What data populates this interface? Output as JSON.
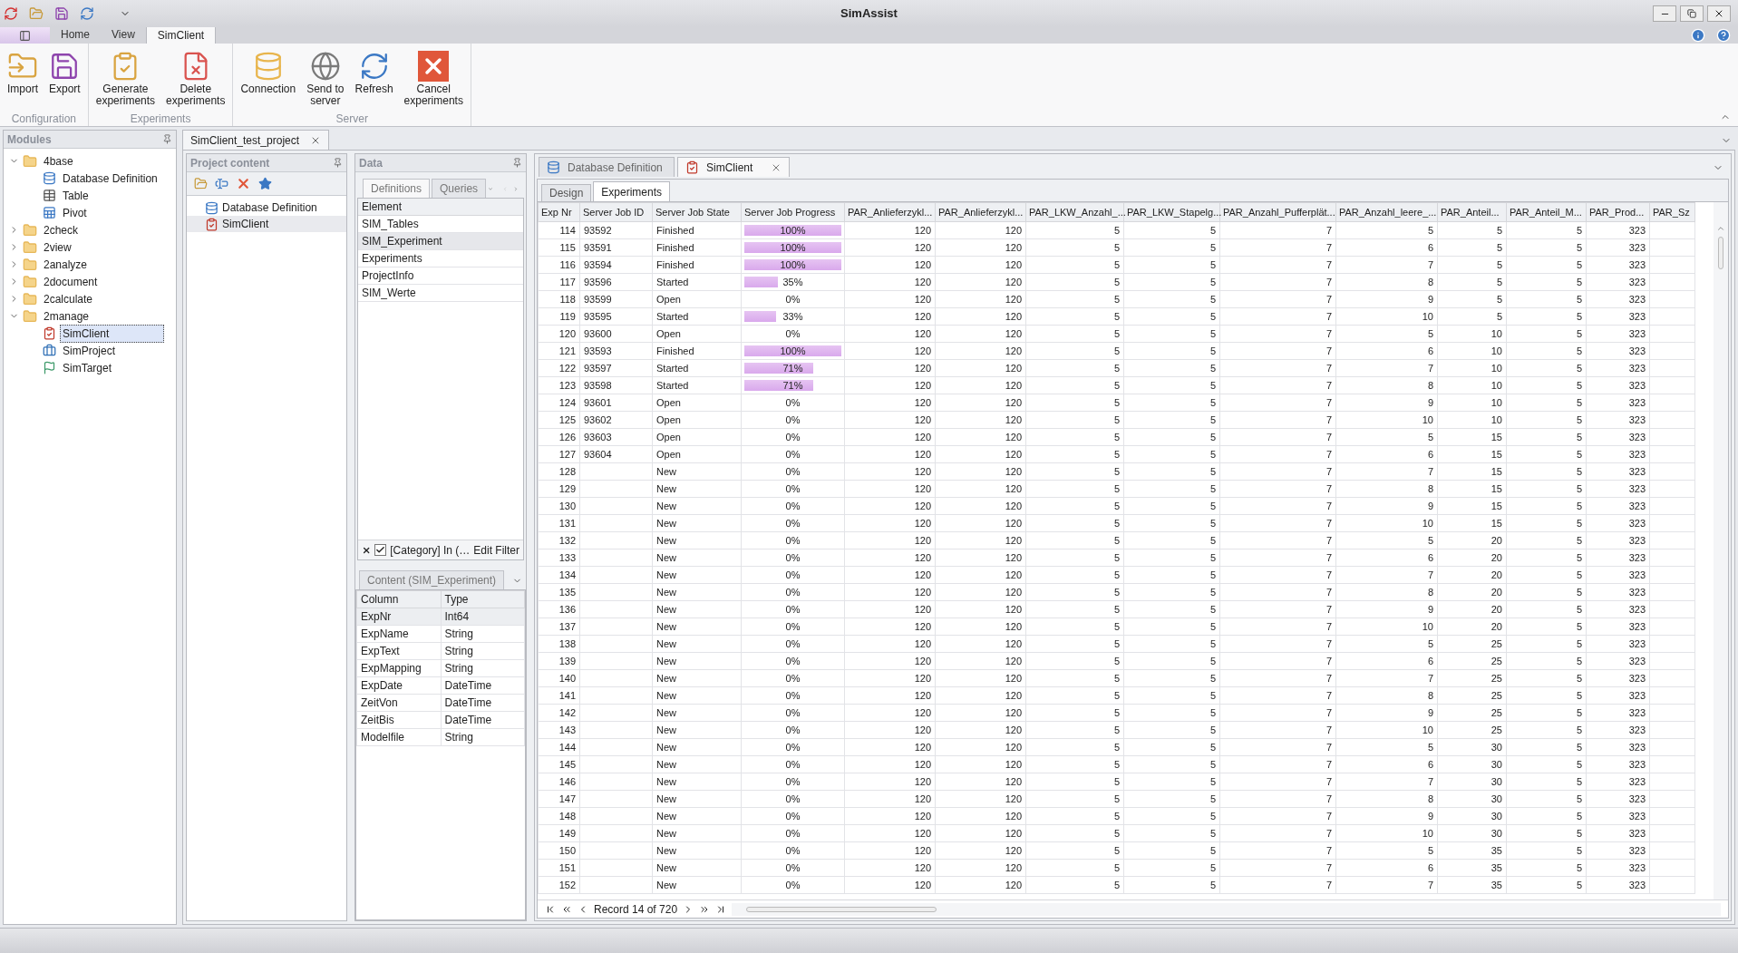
{
  "window": {
    "title": "SimAssist"
  },
  "ribbon": {
    "tabs": [
      {
        "label": "Home",
        "selected": false
      },
      {
        "label": "View",
        "selected": false
      },
      {
        "label": "SimClient",
        "selected": true
      }
    ],
    "groups": [
      {
        "label": "Configuration",
        "buttons": [
          {
            "kind": "import",
            "label": "Import"
          },
          {
            "kind": "export",
            "label": "Export"
          }
        ]
      },
      {
        "label": "Experiments",
        "buttons": [
          {
            "kind": "generate",
            "label": "Generate\nexperiments"
          },
          {
            "kind": "delete",
            "label": "Delete\nexperiments"
          }
        ]
      },
      {
        "label": "Server",
        "buttons": [
          {
            "kind": "connection",
            "label": "Connection"
          },
          {
            "kind": "send",
            "label": "Send to\nserver"
          },
          {
            "kind": "refresh",
            "label": "Refresh"
          },
          {
            "kind": "cancel",
            "label": "Cancel\nexperiments"
          }
        ]
      }
    ]
  },
  "modules": {
    "title": "Modules",
    "tree": [
      {
        "label": "4base",
        "expanded": true,
        "children": [
          {
            "kind": "database",
            "label": "Database Definition",
            "selected": false
          },
          {
            "kind": "table",
            "label": "Table",
            "selected": false
          },
          {
            "kind": "pivot",
            "label": "Pivot",
            "selected": false
          }
        ]
      },
      {
        "label": "2check",
        "expanded": false
      },
      {
        "label": "2view",
        "expanded": false
      },
      {
        "label": "2analyze",
        "expanded": false
      },
      {
        "label": "2document",
        "expanded": false
      },
      {
        "label": "2calculate",
        "expanded": false
      },
      {
        "label": "2manage",
        "expanded": true,
        "children": [
          {
            "kind": "client",
            "label": "SimClient",
            "selected": true
          },
          {
            "kind": "project",
            "label": "SimProject",
            "selected": false
          },
          {
            "kind": "target",
            "label": "SimTarget",
            "selected": false
          }
        ]
      }
    ]
  },
  "document_tab": {
    "label": "SimClient_test_project"
  },
  "project_content": {
    "title": "Project content",
    "items": [
      {
        "kind": "database",
        "label": "Database Definition",
        "selected": false
      },
      {
        "kind": "client",
        "label": "SimClient",
        "selected": true
      }
    ]
  },
  "data": {
    "title": "Data",
    "tabs": [
      {
        "label": "Definitions",
        "selected": true
      },
      {
        "label": "Queries",
        "selected": false
      }
    ],
    "header": "Element",
    "items": [
      {
        "label": "SIM_Tables",
        "selected": false
      },
      {
        "label": "SIM_Experiment",
        "selected": true
      },
      {
        "label": "Experiments",
        "selected": false
      },
      {
        "label": "ProjectInfo",
        "selected": false
      },
      {
        "label": "SIM_Werte",
        "selected": false
      }
    ],
    "filter": {
      "checked": true,
      "text": "[Category] In (…",
      "action": "Edit Filter"
    },
    "content": {
      "title": "Content (SIM_Experiment)",
      "columns": [
        "Column",
        "Type"
      ],
      "rows": [
        {
          "cells": [
            "ExpNr",
            "Int64"
          ],
          "selected": true
        },
        {
          "cells": [
            "ExpName",
            "String"
          ],
          "selected": false
        },
        {
          "cells": [
            "ExpText",
            "String"
          ],
          "selected": false
        },
        {
          "cells": [
            "ExpMapping",
            "String"
          ],
          "selected": false
        },
        {
          "cells": [
            "ExpDate",
            "DateTime"
          ],
          "selected": false
        },
        {
          "cells": [
            "ZeitVon",
            "DateTime"
          ],
          "selected": false
        },
        {
          "cells": [
            "ZeitBis",
            "DateTime"
          ],
          "selected": false
        },
        {
          "cells": [
            "Modelfile",
            "String"
          ],
          "selected": false
        }
      ]
    }
  },
  "editor": {
    "tabs": [
      {
        "kind": "database",
        "label": "Database Definition",
        "selected": false
      },
      {
        "kind": "client",
        "label": "SimClient",
        "selected": true
      }
    ],
    "subtabs": [
      {
        "label": "Design",
        "selected": false
      },
      {
        "label": "Experiments",
        "selected": true
      }
    ],
    "columns": [
      "Exp Nr",
      "Server Job ID",
      "Server Job State",
      "Server Job Progress",
      "PAR_Anlieferzykl...",
      "PAR_Anlieferzykl...",
      "PAR_LKW_Anzahl_...",
      "PAR_LKW_Stapelg...",
      "PAR_Anzahl_Pufferplät...",
      "PAR_Anzahl_leere_...",
      "PAR_Anteil...",
      "PAR_Anteil_M...",
      "PAR_Prod...",
      "PAR_Sz"
    ],
    "rows": [
      {
        "exp_nr": "114",
        "job_id": "93592",
        "state": "Finished",
        "level": 1,
        "progress": "100%",
        "values": [
          "120",
          "120",
          "5",
          "5",
          "7",
          "5",
          "5",
          "5",
          "323"
        ]
      },
      {
        "exp_nr": "115",
        "job_id": "93591",
        "state": "Finished",
        "level": 1,
        "progress": "100%",
        "values": [
          "120",
          "120",
          "5",
          "5",
          "7",
          "6",
          "5",
          "5",
          "323"
        ]
      },
      {
        "exp_nr": "116",
        "job_id": "93594",
        "state": "Finished",
        "level": 1,
        "progress": "100%",
        "values": [
          "120",
          "120",
          "5",
          "5",
          "7",
          "7",
          "5",
          "5",
          "323"
        ]
      },
      {
        "exp_nr": "117",
        "job_id": "93596",
        "state": "Started",
        "level": 0.35,
        "progress": "35%",
        "values": [
          "120",
          "120",
          "5",
          "5",
          "7",
          "8",
          "5",
          "5",
          "323"
        ]
      },
      {
        "exp_nr": "118",
        "job_id": "93599",
        "state": "Open",
        "level": 0,
        "progress": "0%",
        "values": [
          "120",
          "120",
          "5",
          "5",
          "7",
          "9",
          "5",
          "5",
          "323"
        ]
      },
      {
        "exp_nr": "119",
        "job_id": "93595",
        "state": "Started",
        "level": 0.33,
        "progress": "33%",
        "values": [
          "120",
          "120",
          "5",
          "5",
          "7",
          "10",
          "5",
          "5",
          "323"
        ]
      },
      {
        "exp_nr": "120",
        "job_id": "93600",
        "state": "Open",
        "level": 0,
        "progress": "0%",
        "values": [
          "120",
          "120",
          "5",
          "5",
          "7",
          "5",
          "10",
          "5",
          "323"
        ]
      },
      {
        "exp_nr": "121",
        "job_id": "93593",
        "state": "Finished",
        "level": 1,
        "progress": "100%",
        "values": [
          "120",
          "120",
          "5",
          "5",
          "7",
          "6",
          "10",
          "5",
          "323"
        ]
      },
      {
        "exp_nr": "122",
        "job_id": "93597",
        "state": "Started",
        "level": 0.71,
        "progress": "71%",
        "values": [
          "120",
          "120",
          "5",
          "5",
          "7",
          "7",
          "10",
          "5",
          "323"
        ]
      },
      {
        "exp_nr": "123",
        "job_id": "93598",
        "state": "Started",
        "level": 0.71,
        "progress": "71%",
        "values": [
          "120",
          "120",
          "5",
          "5",
          "7",
          "8",
          "10",
          "5",
          "323"
        ]
      },
      {
        "exp_nr": "124",
        "job_id": "93601",
        "state": "Open",
        "level": 0,
        "progress": "0%",
        "values": [
          "120",
          "120",
          "5",
          "5",
          "7",
          "9",
          "10",
          "5",
          "323"
        ]
      },
      {
        "exp_nr": "125",
        "job_id": "93602",
        "state": "Open",
        "level": 0,
        "progress": "0%",
        "values": [
          "120",
          "120",
          "5",
          "5",
          "7",
          "10",
          "10",
          "5",
          "323"
        ]
      },
      {
        "exp_nr": "126",
        "job_id": "93603",
        "state": "Open",
        "level": 0,
        "progress": "0%",
        "values": [
          "120",
          "120",
          "5",
          "5",
          "7",
          "5",
          "15",
          "5",
          "323"
        ]
      },
      {
        "exp_nr": "127",
        "job_id": "93604",
        "state": "Open",
        "level": 0,
        "progress": "0%",
        "values": [
          "120",
          "120",
          "5",
          "5",
          "7",
          "6",
          "15",
          "5",
          "323"
        ]
      },
      {
        "exp_nr": "128",
        "state": "New",
        "level": 0,
        "progress": "0%",
        "values": [
          "120",
          "120",
          "5",
          "5",
          "7",
          "7",
          "15",
          "5",
          "323"
        ]
      },
      {
        "exp_nr": "129",
        "state": "New",
        "level": 0,
        "progress": "0%",
        "values": [
          "120",
          "120",
          "5",
          "5",
          "7",
          "8",
          "15",
          "5",
          "323"
        ]
      },
      {
        "exp_nr": "130",
        "state": "New",
        "level": 0,
        "progress": "0%",
        "values": [
          "120",
          "120",
          "5",
          "5",
          "7",
          "9",
          "15",
          "5",
          "323"
        ]
      },
      {
        "exp_nr": "131",
        "state": "New",
        "level": 0,
        "progress": "0%",
        "values": [
          "120",
          "120",
          "5",
          "5",
          "7",
          "10",
          "15",
          "5",
          "323"
        ]
      },
      {
        "exp_nr": "132",
        "state": "New",
        "level": 0,
        "progress": "0%",
        "values": [
          "120",
          "120",
          "5",
          "5",
          "7",
          "5",
          "20",
          "5",
          "323"
        ]
      },
      {
        "exp_nr": "133",
        "state": "New",
        "level": 0,
        "progress": "0%",
        "values": [
          "120",
          "120",
          "5",
          "5",
          "7",
          "6",
          "20",
          "5",
          "323"
        ]
      },
      {
        "exp_nr": "134",
        "state": "New",
        "level": 0,
        "progress": "0%",
        "values": [
          "120",
          "120",
          "5",
          "5",
          "7",
          "7",
          "20",
          "5",
          "323"
        ]
      },
      {
        "exp_nr": "135",
        "state": "New",
        "level": 0,
        "progress": "0%",
        "values": [
          "120",
          "120",
          "5",
          "5",
          "7",
          "8",
          "20",
          "5",
          "323"
        ]
      },
      {
        "exp_nr": "136",
        "state": "New",
        "level": 0,
        "progress": "0%",
        "values": [
          "120",
          "120",
          "5",
          "5",
          "7",
          "9",
          "20",
          "5",
          "323"
        ]
      },
      {
        "exp_nr": "137",
        "state": "New",
        "level": 0,
        "progress": "0%",
        "values": [
          "120",
          "120",
          "5",
          "5",
          "7",
          "10",
          "20",
          "5",
          "323"
        ]
      },
      {
        "exp_nr": "138",
        "state": "New",
        "level": 0,
        "progress": "0%",
        "values": [
          "120",
          "120",
          "5",
          "5",
          "7",
          "5",
          "25",
          "5",
          "323"
        ]
      },
      {
        "exp_nr": "139",
        "state": "New",
        "level": 0,
        "progress": "0%",
        "values": [
          "120",
          "120",
          "5",
          "5",
          "7",
          "6",
          "25",
          "5",
          "323"
        ]
      },
      {
        "exp_nr": "140",
        "state": "New",
        "level": 0,
        "progress": "0%",
        "values": [
          "120",
          "120",
          "5",
          "5",
          "7",
          "7",
          "25",
          "5",
          "323"
        ]
      },
      {
        "exp_nr": "141",
        "state": "New",
        "level": 0,
        "progress": "0%",
        "values": [
          "120",
          "120",
          "5",
          "5",
          "7",
          "8",
          "25",
          "5",
          "323"
        ]
      },
      {
        "exp_nr": "142",
        "state": "New",
        "level": 0,
        "progress": "0%",
        "values": [
          "120",
          "120",
          "5",
          "5",
          "7",
          "9",
          "25",
          "5",
          "323"
        ]
      },
      {
        "exp_nr": "143",
        "state": "New",
        "level": 0,
        "progress": "0%",
        "values": [
          "120",
          "120",
          "5",
          "5",
          "7",
          "10",
          "25",
          "5",
          "323"
        ]
      },
      {
        "exp_nr": "144",
        "state": "New",
        "level": 0,
        "progress": "0%",
        "values": [
          "120",
          "120",
          "5",
          "5",
          "7",
          "5",
          "30",
          "5",
          "323"
        ]
      },
      {
        "exp_nr": "145",
        "state": "New",
        "level": 0,
        "progress": "0%",
        "values": [
          "120",
          "120",
          "5",
          "5",
          "7",
          "6",
          "30",
          "5",
          "323"
        ]
      },
      {
        "exp_nr": "146",
        "state": "New",
        "level": 0,
        "progress": "0%",
        "values": [
          "120",
          "120",
          "5",
          "5",
          "7",
          "7",
          "30",
          "5",
          "323"
        ]
      },
      {
        "exp_nr": "147",
        "state": "New",
        "level": 0,
        "progress": "0%",
        "values": [
          "120",
          "120",
          "5",
          "5",
          "7",
          "8",
          "30",
          "5",
          "323"
        ]
      },
      {
        "exp_nr": "148",
        "state": "New",
        "level": 0,
        "progress": "0%",
        "values": [
          "120",
          "120",
          "5",
          "5",
          "7",
          "9",
          "30",
          "5",
          "323"
        ]
      },
      {
        "exp_nr": "149",
        "state": "New",
        "level": 0,
        "progress": "0%",
        "values": [
          "120",
          "120",
          "5",
          "5",
          "7",
          "10",
          "30",
          "5",
          "323"
        ]
      },
      {
        "exp_nr": "150",
        "state": "New",
        "level": 0,
        "progress": "0%",
        "values": [
          "120",
          "120",
          "5",
          "5",
          "7",
          "5",
          "35",
          "5",
          "323"
        ]
      },
      {
        "exp_nr": "151",
        "state": "New",
        "level": 0,
        "progress": "0%",
        "values": [
          "120",
          "120",
          "5",
          "5",
          "7",
          "6",
          "35",
          "5",
          "323"
        ]
      },
      {
        "exp_nr": "152",
        "state": "New",
        "level": 0,
        "progress": "0%",
        "values": [
          "120",
          "120",
          "5",
          "5",
          "7",
          "7",
          "35",
          "5",
          "323"
        ]
      }
    ],
    "navigator": "Record 14 of 720"
  }
}
